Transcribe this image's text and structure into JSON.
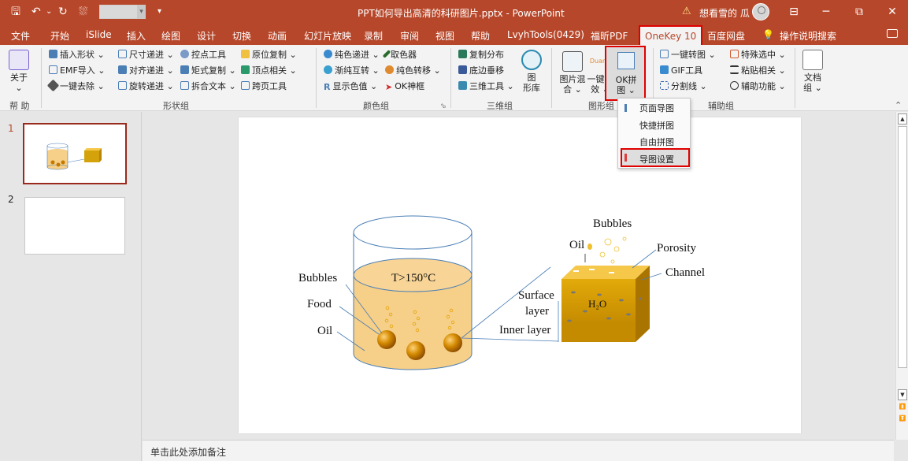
{
  "title_bar": {
    "qa_save": "🖫",
    "qa_undo": "↶",
    "qa_undo_drop": "⌄",
    "qa_redo": "↻",
    "qa_extra": "⛆",
    "qa_custom": "▾",
    "document_title": "PPT如何导出高清的科研图片.pptx  -  PowerPoint",
    "warning_icon": "⚠",
    "user_name": "想看雪的 瓜",
    "win_ribbon": "⊟",
    "win_min": "─",
    "win_max": "⧉",
    "win_close": "✕"
  },
  "tabs": [
    "文件",
    "开始",
    "iSlide",
    "插入",
    "绘图",
    "设计",
    "切换",
    "动画",
    "幻灯片放映",
    "录制",
    "审阅",
    "视图",
    "帮助",
    "LvyhTools(0429)",
    "福昕PDF",
    "OneKey 10",
    "百度网盘"
  ],
  "tell_me": "操作说明搜索",
  "tell_me_icon": "💡",
  "ribbon": {
    "help_group": {
      "about": "关于",
      "about_arrow": "⌄",
      "label": "帮 助"
    },
    "shape_group": {
      "col1": [
        "插入形状 ⌄",
        "EMF导入 ⌄",
        "一键去除 ⌄"
      ],
      "col2": [
        "尺寸递进 ⌄",
        "对齐递进 ⌄",
        "旋转递进 ⌄"
      ],
      "col3": [
        "控点工具",
        "矩式复制 ⌄",
        "拆合文本 ⌄"
      ],
      "col4": [
        "原位复制 ⌄",
        "顶点相关 ⌄",
        "跨页工具"
      ],
      "label": "形状组"
    },
    "color_group": {
      "col1": [
        "纯色递进 ⌄",
        "渐纯互转 ⌄",
        "显示色值 ⌄"
      ],
      "col2": [
        "取色器",
        "纯色转移 ⌄",
        "OK神框"
      ],
      "label": "颜色组"
    },
    "threed_group": {
      "items": [
        "复制分布",
        "底边垂移",
        "三维工具 ⌄"
      ],
      "library_label": "图\n形库",
      "label": "三维组"
    },
    "image_group": {
      "mix": "图片混\n合 ⌄",
      "effect": "一键特\n效 ⌄",
      "ok_pinjie": "OK拼\n图 ⌄",
      "duang": "Duang",
      "label": "图形组"
    },
    "aux_group": {
      "col1": [
        "一键转图 ⌄",
        "GIF工具",
        "分割线 ⌄"
      ],
      "col2": [
        "特殊选中 ⌄",
        "粘贴相关 ⌄",
        "辅助功能 ⌄"
      ],
      "label": "辅助组"
    },
    "doc_group": {
      "label_btn": "文档\n组 ⌄"
    },
    "collapse": "⌃"
  },
  "dropdown": [
    "页面导图",
    "快捷拼图",
    "自由拼图",
    "导图设置"
  ],
  "slides": [
    "1",
    "2"
  ],
  "notes_placeholder": "单击此处添加备注",
  "figure": {
    "temp": "T>150°C",
    "bubbles_left": "Bubbles",
    "food": "Food",
    "oil_left": "Oil",
    "bubbles_right": "Bubbles",
    "oil_right": "Oil",
    "porosity": "Porosity",
    "channel": "Channel",
    "surface": "Surface",
    "layer": "layer",
    "inner": "Inner layer",
    "h2o": "H₂O"
  },
  "colors": {
    "accent": "#b7472a",
    "highlight": "#e00000",
    "oil_fill": "#f6cf88",
    "food": "#c47a00"
  }
}
